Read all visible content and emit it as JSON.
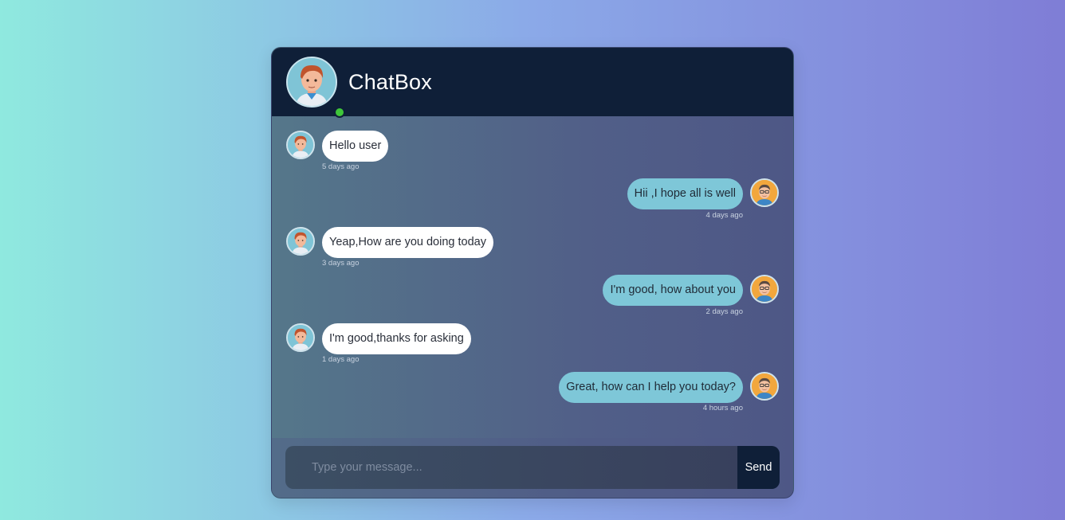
{
  "app": {
    "title": "ChatBox",
    "status_color": "#3fc63a"
  },
  "messages": [
    {
      "side": "left",
      "text": "Hello user",
      "time": "5 days ago",
      "avatar": "male-red-hair-avatar"
    },
    {
      "side": "right",
      "text": "Hii ,I hope all is well",
      "time": "4 days ago",
      "avatar": "male-glasses-avatar"
    },
    {
      "side": "left",
      "text": "Yeap,How are you doing today",
      "time": "3 days ago",
      "avatar": "male-red-hair-avatar"
    },
    {
      "side": "right",
      "text": "I'm good, how about you",
      "time": "2 days ago",
      "avatar": "male-glasses-avatar"
    },
    {
      "side": "left",
      "text": "I'm good,thanks for asking",
      "time": "1 days ago",
      "avatar": "male-red-hair-avatar"
    },
    {
      "side": "right",
      "text": "Great, how can I help you today?",
      "time": "4 hours ago",
      "avatar": "male-glasses-avatar"
    }
  ],
  "composer": {
    "placeholder": "Type your message...",
    "value": "",
    "send_label": "Send"
  }
}
